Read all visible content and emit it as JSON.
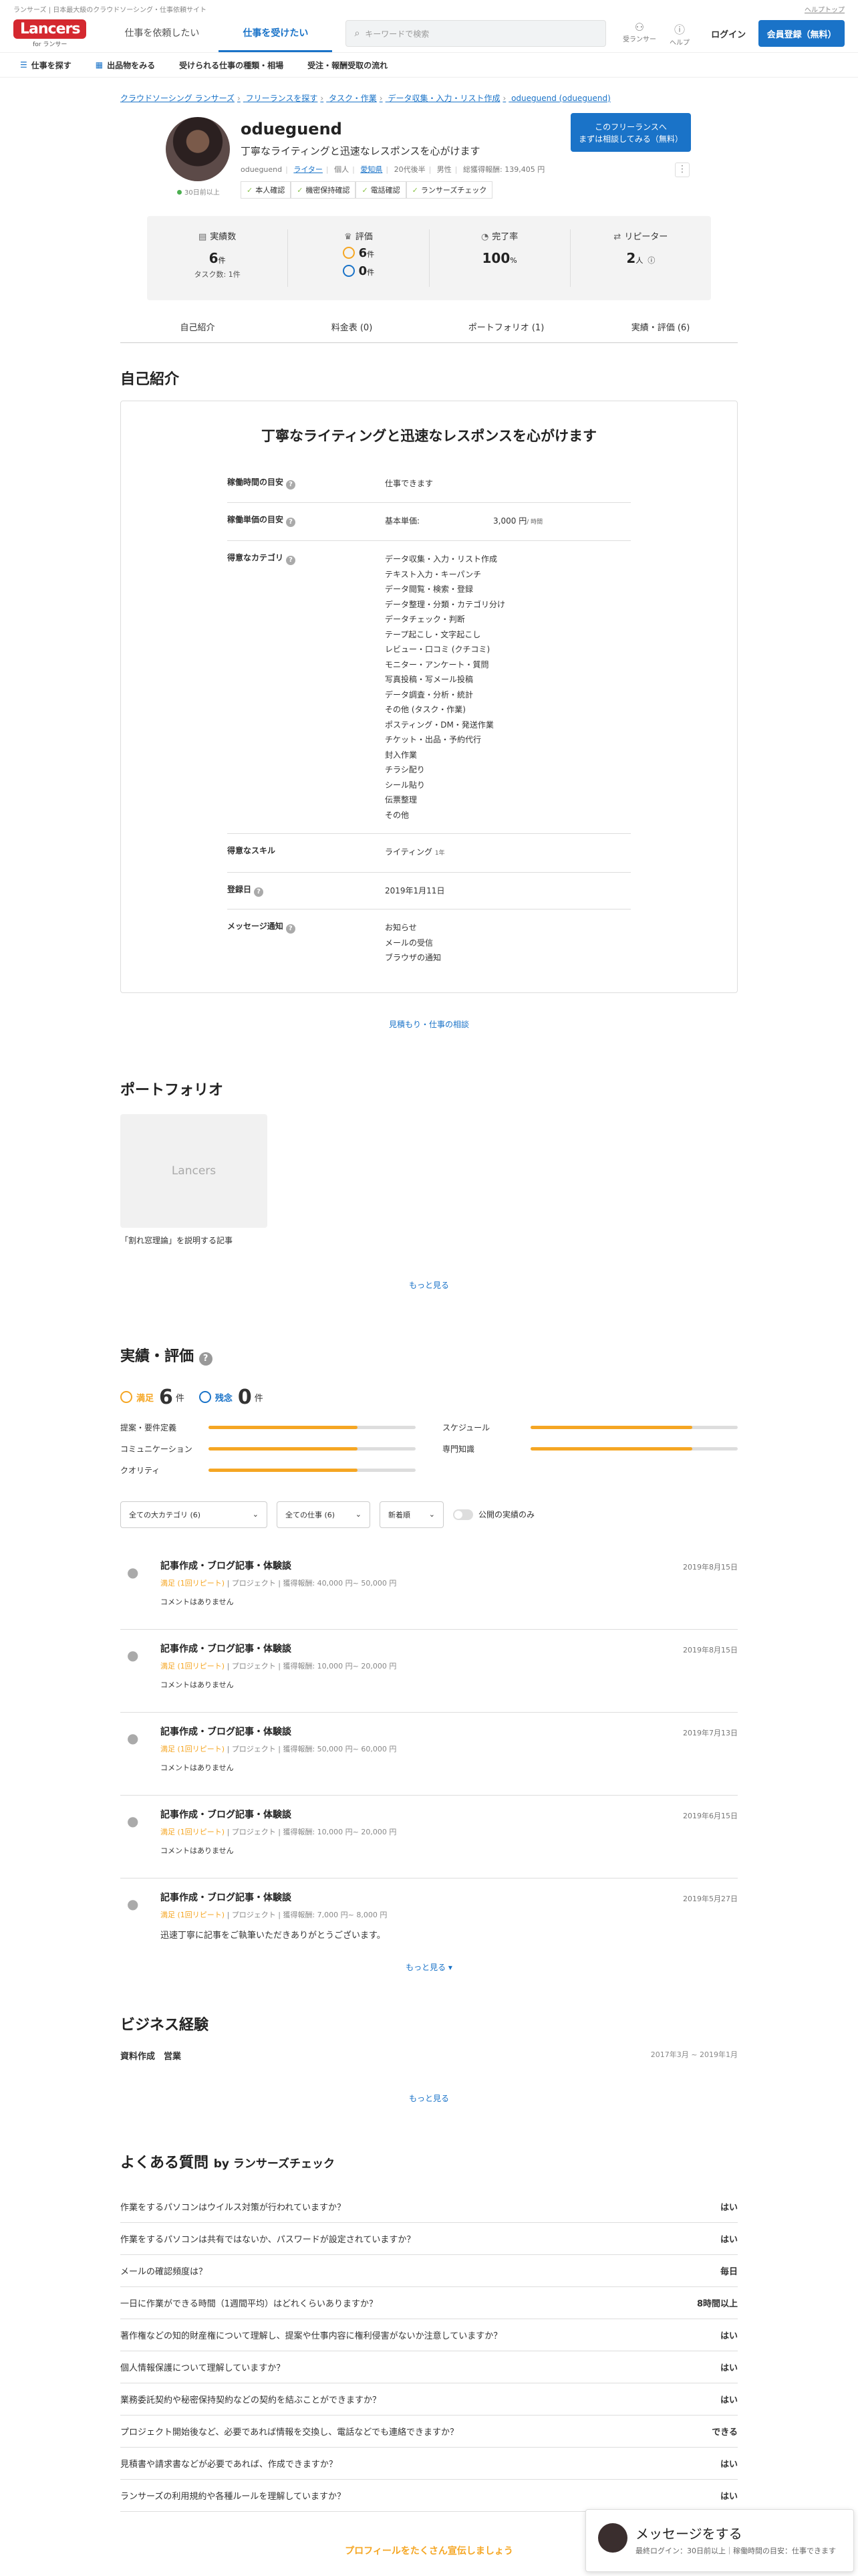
{
  "topstrip": {
    "left": "ランサーズ | 日本最大級のクラウドソーシング・仕事依頼サイト",
    "right": "ヘルプトップ"
  },
  "header": {
    "logo": "Lancers",
    "logo_sub": "for ランサー",
    "tabs": [
      "仕事を依頼したい",
      "仕事を受けたい"
    ],
    "search_placeholder": "キーワードで検索",
    "icons": [
      {
        "label": "受ランサー",
        "icon": "person-icon"
      },
      {
        "label": "ヘルプ",
        "icon": "help-icon"
      }
    ],
    "login": "ログイン",
    "signup": "会員登録（無料）"
  },
  "subnav": [
    "仕事を探す",
    "出品物をみる",
    "受けられる仕事の種類・相場",
    "受注・報酬受取の流れ"
  ],
  "breadcrumb": [
    "クラウドソーシング ランサーズ",
    "フリーランスを探す",
    "タスク・作業",
    "データ収集・入力・リスト作成",
    "odueguend (odueguend)"
  ],
  "profile": {
    "name": "odueguend",
    "tagline": "丁寧なライティングと迅速なレスポンスを心がけます",
    "online": "30日前以上",
    "meta": [
      "odueguend",
      "ライター",
      "個人",
      "愛知県",
      "20代後半",
      "男性",
      "総獲得報酬: 139,405 円"
    ],
    "checks": [
      "本人確認",
      "機密保持確認",
      "電話確認",
      "ランサーズチェック"
    ],
    "cta_line1": "このフリーランスへ",
    "cta_line2": "まずは相談してみる（無料）"
  },
  "stats": {
    "jisseki_label": "実績数",
    "jisseki_value": "6",
    "jisseki_unit": "件",
    "jisseki_sub": "タスク数: 1件",
    "hyoka_label": "評価",
    "hyoka_good": "6",
    "hyoka_bad": "0",
    "hyoka_unit": "件",
    "kanryo_label": "完了率",
    "kanryo_value": "100",
    "kanryo_unit": "%",
    "repeat_label": "リピーター",
    "repeat_value": "2",
    "repeat_unit": "人"
  },
  "ptabs": [
    "自己紹介",
    "料金表 (0)",
    "ポートフォリオ (1)",
    "実績・評価 (6)"
  ],
  "intro": {
    "section": "自己紹介",
    "heading": "丁寧なライティングと迅速なレスポンスを心がけます",
    "rows": [
      {
        "k": "稼働時間の目安",
        "v": "仕事できます"
      },
      {
        "k": "稼働単価の目安",
        "v1": "基本単価:",
        "v2": "3,000 円",
        "v3": "/ 時間"
      },
      {
        "k": "得意なカテゴリ",
        "list": [
          "データ収集・入力・リスト作成",
          "テキスト入力・キーパンチ",
          "データ閲覧・検索・登録",
          "データ整理・分類・カテゴリ分け",
          "データチェック・判断",
          "テープ起こし・文字起こし",
          "レビュー・口コミ (クチコミ)",
          "モニター・アンケート・質問",
          "写真投稿・写メール投稿",
          "データ調査・分析・統計",
          "その他 (タスク・作業)",
          "ポスティング・DM・発送作業",
          "チケット・出品・予約代行",
          "封入作業",
          "チラシ配り",
          "シール貼り",
          "伝票整理",
          "その他"
        ]
      },
      {
        "k": "得意なスキル",
        "v1": "ライティング",
        "v2": "1年"
      },
      {
        "k": "登録日",
        "v": "2019年1月11日"
      },
      {
        "k": "メッセージ通知",
        "list": [
          "お知らせ",
          "メールの受信",
          "ブラウザの通知"
        ]
      }
    ],
    "more": "見積もり・仕事の相談"
  },
  "portfolio": {
    "section": "ポートフォリオ",
    "thumb": "Lancers",
    "caption": "「割れ窓理論」を説明する記事",
    "more": "もっと見る"
  },
  "reviews": {
    "section": "実績・評価",
    "good_label": "満足",
    "good_count": "6",
    "bad_label": "残念",
    "bad_count": "0",
    "unit": "件",
    "bars": [
      {
        "label": "提案・要件定義",
        "value": 0.72
      },
      {
        "label": "スケジュール",
        "value": 0.78
      },
      {
        "label": "コミュニケーション",
        "value": 0.72
      },
      {
        "label": "専門知識",
        "value": 0.78
      },
      {
        "label": "クオリティ",
        "value": 0.72
      }
    ],
    "filters": [
      "全ての大カテゴリ (6)",
      "全ての仕事 (6)",
      "新着順"
    ],
    "toggle": "公開の実績のみ",
    "items": [
      {
        "title": "記事作成・ブログ記事・体験談",
        "date": "2019年8月15日",
        "rating": "満足 (1回リピート)",
        "kind": "プロジェクト",
        "fee": "獲得報酬: 40,000 円~ 50,000 円",
        "comment": "コメントはありません"
      },
      {
        "title": "記事作成・ブログ記事・体験談",
        "date": "2019年8月15日",
        "rating": "満足 (1回リピート)",
        "kind": "プロジェクト",
        "fee": "獲得報酬: 10,000 円~ 20,000 円",
        "comment": "コメントはありません"
      },
      {
        "title": "記事作成・ブログ記事・体験談",
        "date": "2019年7月13日",
        "rating": "満足 (1回リピート)",
        "kind": "プロジェクト",
        "fee": "獲得報酬: 50,000 円~ 60,000 円",
        "comment": "コメントはありません"
      },
      {
        "title": "記事作成・ブログ記事・体験談",
        "date": "2019年6月15日",
        "rating": "満足 (1回リピート)",
        "kind": "プロジェクト",
        "fee": "獲得報酬: 10,000 円~ 20,000 円",
        "comment": "コメントはありません"
      },
      {
        "title": "記事作成・ブログ記事・体験談",
        "date": "2019年5月27日",
        "rating": "満足 (1回リピート)",
        "kind": "プロジェクト",
        "fee": "獲得報酬: 7,000 円~ 8,000 円",
        "comment": "迅速丁寧に記事をご執筆いただきありがとうございます。"
      }
    ],
    "more": "もっと見る"
  },
  "business": {
    "section": "ビジネス経験",
    "title": "資料作成　営業",
    "dates": "2017年3月 ~ 2019年1月",
    "more": "もっと見る"
  },
  "faq": {
    "section": "よくある質問",
    "by": "by ランサーズチェック",
    "rows": [
      {
        "q": "作業をするパソコンはウイルス対策が行われていますか？",
        "a": "はい"
      },
      {
        "q": "作業をするパソコンは共有ではないか、パスワードが設定されていますか？",
        "a": "はい"
      },
      {
        "q": "メールの確認頻度は？",
        "a": "毎日"
      },
      {
        "q": "一日に作業ができる時間（1週間平均）はどれくらいありますか？",
        "a": "8時間以上"
      },
      {
        "q": "著作権などの知的財産権について理解し、提案や仕事内容に権利侵害がないか注意していますか？",
        "a": "はい"
      },
      {
        "q": "個人情報保護について理解していますか？",
        "a": "はい"
      },
      {
        "q": "業務委託契約や秘密保持契約などの契約を結ぶことができますか？",
        "a": "はい"
      },
      {
        "q": "プロジェクト開始後など、必要であれば情報を交換し、電話などでも連絡できますか？",
        "a": "できる"
      },
      {
        "q": "見積書や請求書などが必要であれば、作成できますか？",
        "a": "はい"
      },
      {
        "q": "ランサーズの利用規約や各種ルールを理解していますか？",
        "a": "はい"
      }
    ]
  },
  "promo": "プロフィールをたくさん宣伝しましょう",
  "message_box": {
    "title": "メッセージをする",
    "sub": "最終ログイン：30日前以上｜稼働時間の目安：仕事できます"
  }
}
